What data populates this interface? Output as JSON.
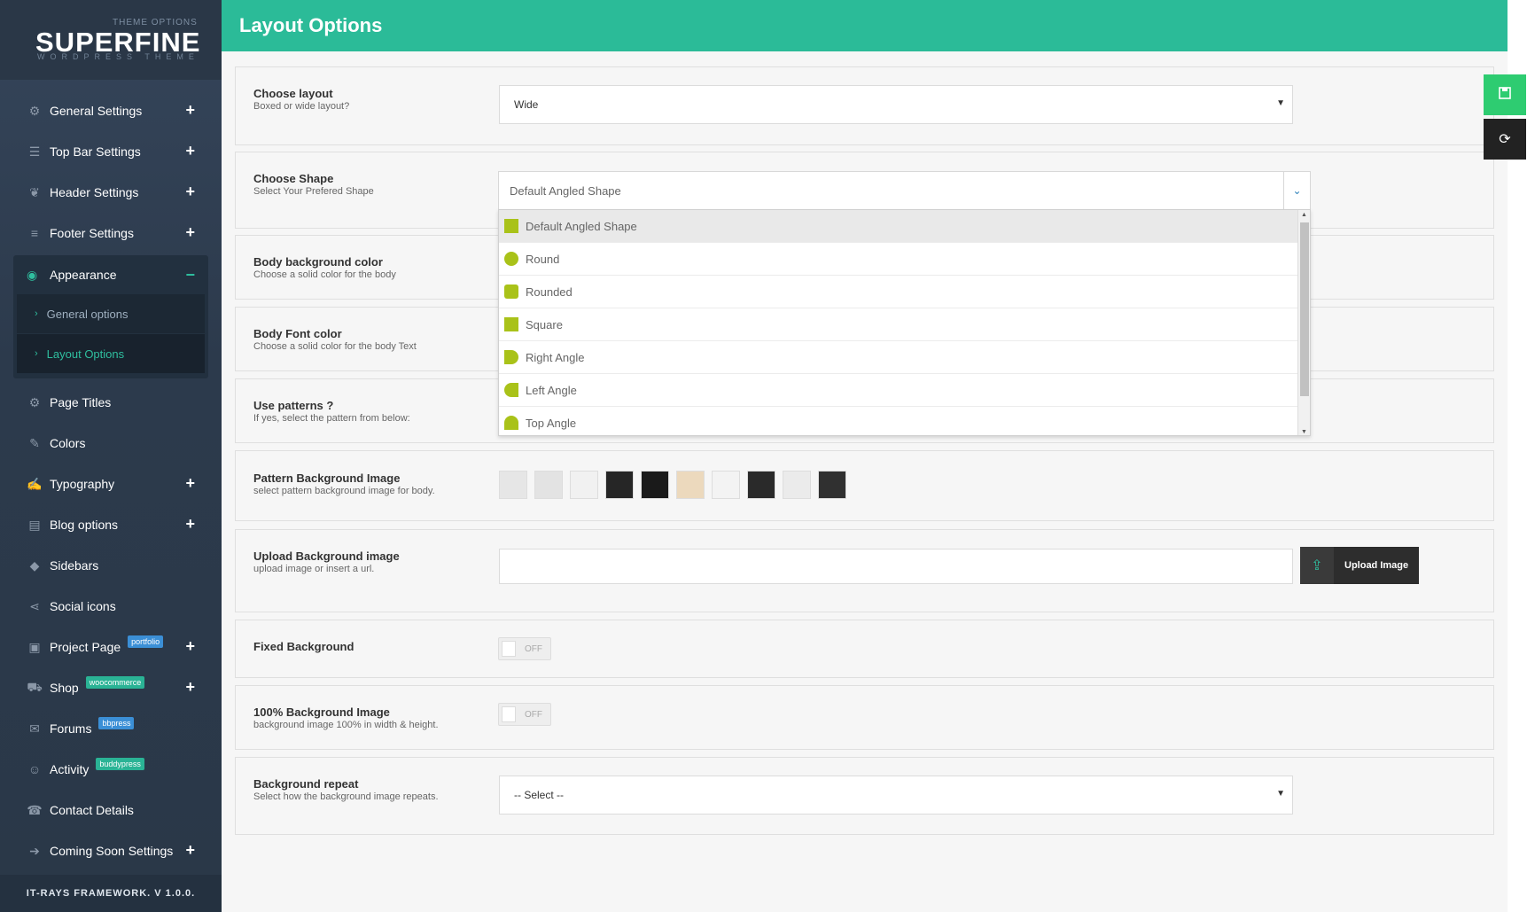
{
  "brand": {
    "small": "THEME OPTIONS",
    "name": "SUPERFINE",
    "sub": "WORDPRESS THEME"
  },
  "sidebar": {
    "items": [
      {
        "label": "General Settings",
        "icon": "gears-icon",
        "expand": "+"
      },
      {
        "label": "Top Bar Settings",
        "icon": "bars-icon",
        "expand": "+"
      },
      {
        "label": "Header Settings",
        "icon": "leaf-icon",
        "expand": "+"
      },
      {
        "label": "Footer Settings",
        "icon": "sliders-icon",
        "expand": "+"
      }
    ],
    "group": {
      "label": "Appearance",
      "icon": "palette-icon",
      "collapse": "−",
      "children": [
        {
          "label": "General options"
        },
        {
          "label": "Layout Options"
        }
      ]
    },
    "items2": [
      {
        "label": "Page Titles",
        "icon": "gear-icon"
      },
      {
        "label": "Colors",
        "icon": "brush-icon"
      },
      {
        "label": "Typography",
        "icon": "edit-icon",
        "expand": "+"
      },
      {
        "label": "Blog options",
        "icon": "book-icon",
        "expand": "+"
      },
      {
        "label": "Sidebars",
        "icon": "tags-icon"
      },
      {
        "label": "Social icons",
        "icon": "share-icon"
      },
      {
        "label": "Project Page",
        "icon": "gift-icon",
        "badge": "portfolio",
        "expand": "+"
      },
      {
        "label": "Shop",
        "icon": "cart-icon",
        "badge": "woocommerce",
        "expand": "+"
      },
      {
        "label": "Forums",
        "icon": "comments-icon",
        "badge": "bbpress"
      },
      {
        "label": "Activity",
        "icon": "users-icon",
        "badge": "buddypress"
      },
      {
        "label": "Contact Details",
        "icon": "phone-icon"
      },
      {
        "label": "Coming Soon Settings",
        "icon": "sign-in-icon",
        "expand": "+"
      }
    ],
    "footer": "IT-RAYS FRAMEWORK. V 1.0.0."
  },
  "page": {
    "title": "Layout Options"
  },
  "options": {
    "layout": {
      "title": "Choose layout",
      "desc": "Boxed or wide layout?",
      "value": "Wide"
    },
    "shape": {
      "title": "Choose Shape",
      "desc": "Select Your Prefered Shape",
      "value": "Default Angled Shape",
      "options": [
        "Default Angled Shape",
        "Round",
        "Rounded",
        "Square",
        "Right Angle",
        "Left Angle",
        "Top Angle"
      ]
    },
    "body_bg": {
      "title": "Body background color",
      "desc": "Choose a solid color for the body"
    },
    "font_color": {
      "title": "Body Font color",
      "desc": "Choose a solid color for the body Text"
    },
    "patterns": {
      "title": "Use patterns ?",
      "desc": "If yes, select the pattern from below:"
    },
    "pattern_bg": {
      "title": "Pattern Background Image",
      "desc": "select pattern background image for body.",
      "swatches": [
        "#e6e6e6",
        "#e3e3e3",
        "#f1f1f1",
        "#262626",
        "#1a1a1a",
        "#ecd9bd",
        "#f3f3f3",
        "#2a2a2a",
        "#ebebeb",
        "#303030"
      ]
    },
    "upload": {
      "title": "Upload Background image",
      "desc": "upload image or insert a url.",
      "button": "Upload Image"
    },
    "fixed": {
      "title": "Fixed Background",
      "toggle": "OFF"
    },
    "full": {
      "title": "100% Background Image",
      "desc": "background image 100% in width & height.",
      "toggle": "OFF"
    },
    "repeat": {
      "title": "Background repeat",
      "desc": "Select how the background image repeats.",
      "value": "-- Select --"
    }
  },
  "colors": {
    "accent": "#2bbb98",
    "shape": "#a9c219",
    "save": "#2ecc71"
  }
}
